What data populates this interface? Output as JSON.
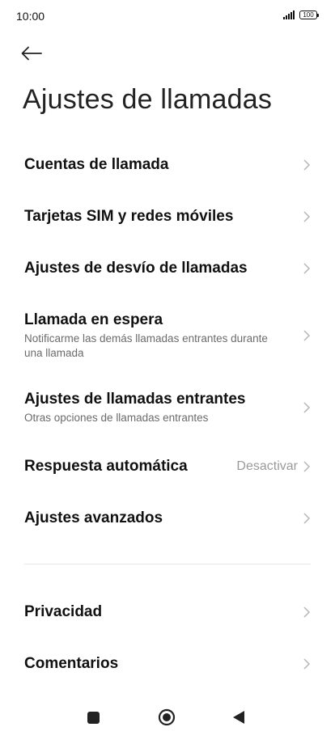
{
  "status_bar": {
    "time": "10:00",
    "battery": "100",
    "icons": [
      "signal-icon",
      "battery-icon"
    ]
  },
  "header": {
    "back_icon": "arrow-left-icon",
    "title": "Ajustes de llamadas"
  },
  "settings": [
    {
      "label": "Cuentas de llamada",
      "subtitle": "",
      "value": ""
    },
    {
      "label": "Tarjetas SIM y redes móviles",
      "subtitle": "",
      "value": ""
    },
    {
      "label": "Ajustes de desvío de llamadas",
      "subtitle": "",
      "value": ""
    },
    {
      "label": "Llamada en espera",
      "subtitle": "Notificarme las demás llamadas entrantes durante una llamada",
      "value": ""
    },
    {
      "label": "Ajustes de llamadas entrantes",
      "subtitle": "Otras opciones de llamadas entrantes",
      "value": ""
    },
    {
      "label": "Respuesta automática",
      "subtitle": "",
      "value": "Desactivar"
    },
    {
      "label": "Ajustes avanzados",
      "subtitle": "",
      "value": ""
    }
  ],
  "settings_secondary": [
    {
      "label": "Privacidad"
    },
    {
      "label": "Comentarios"
    }
  ],
  "nav_bar": {
    "icons": [
      "recents-square-icon",
      "home-circle-icon",
      "back-triangle-icon"
    ]
  },
  "colors": {
    "background": "#ffffff",
    "text_primary": "#111111",
    "text_secondary": "#6b6b6b",
    "value_text": "#9a9a9a",
    "chevron": "#b5b5b5",
    "divider": "#e6e6e6"
  }
}
